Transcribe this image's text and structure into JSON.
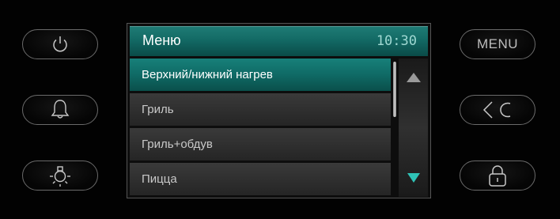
{
  "screen": {
    "title": "Меню",
    "clock": "10:30"
  },
  "menu_items": [
    {
      "label": "Верхний/нижний нагрев",
      "selected": true
    },
    {
      "label": "Гриль",
      "selected": false
    },
    {
      "label": "Гриль+обдув",
      "selected": false
    },
    {
      "label": "Пицца",
      "selected": false
    }
  ],
  "buttons": {
    "menu_label": "MENU"
  },
  "icons": {
    "power": "power-icon",
    "bell": "bell-icon",
    "light": "light-icon",
    "back": "back-icon",
    "lock": "lock-icon",
    "scroll_up": "arrow-up-icon",
    "scroll_down": "arrow-down-icon"
  },
  "colors": {
    "accent": "#136a65",
    "arrow_active": "#2fc2b6"
  }
}
